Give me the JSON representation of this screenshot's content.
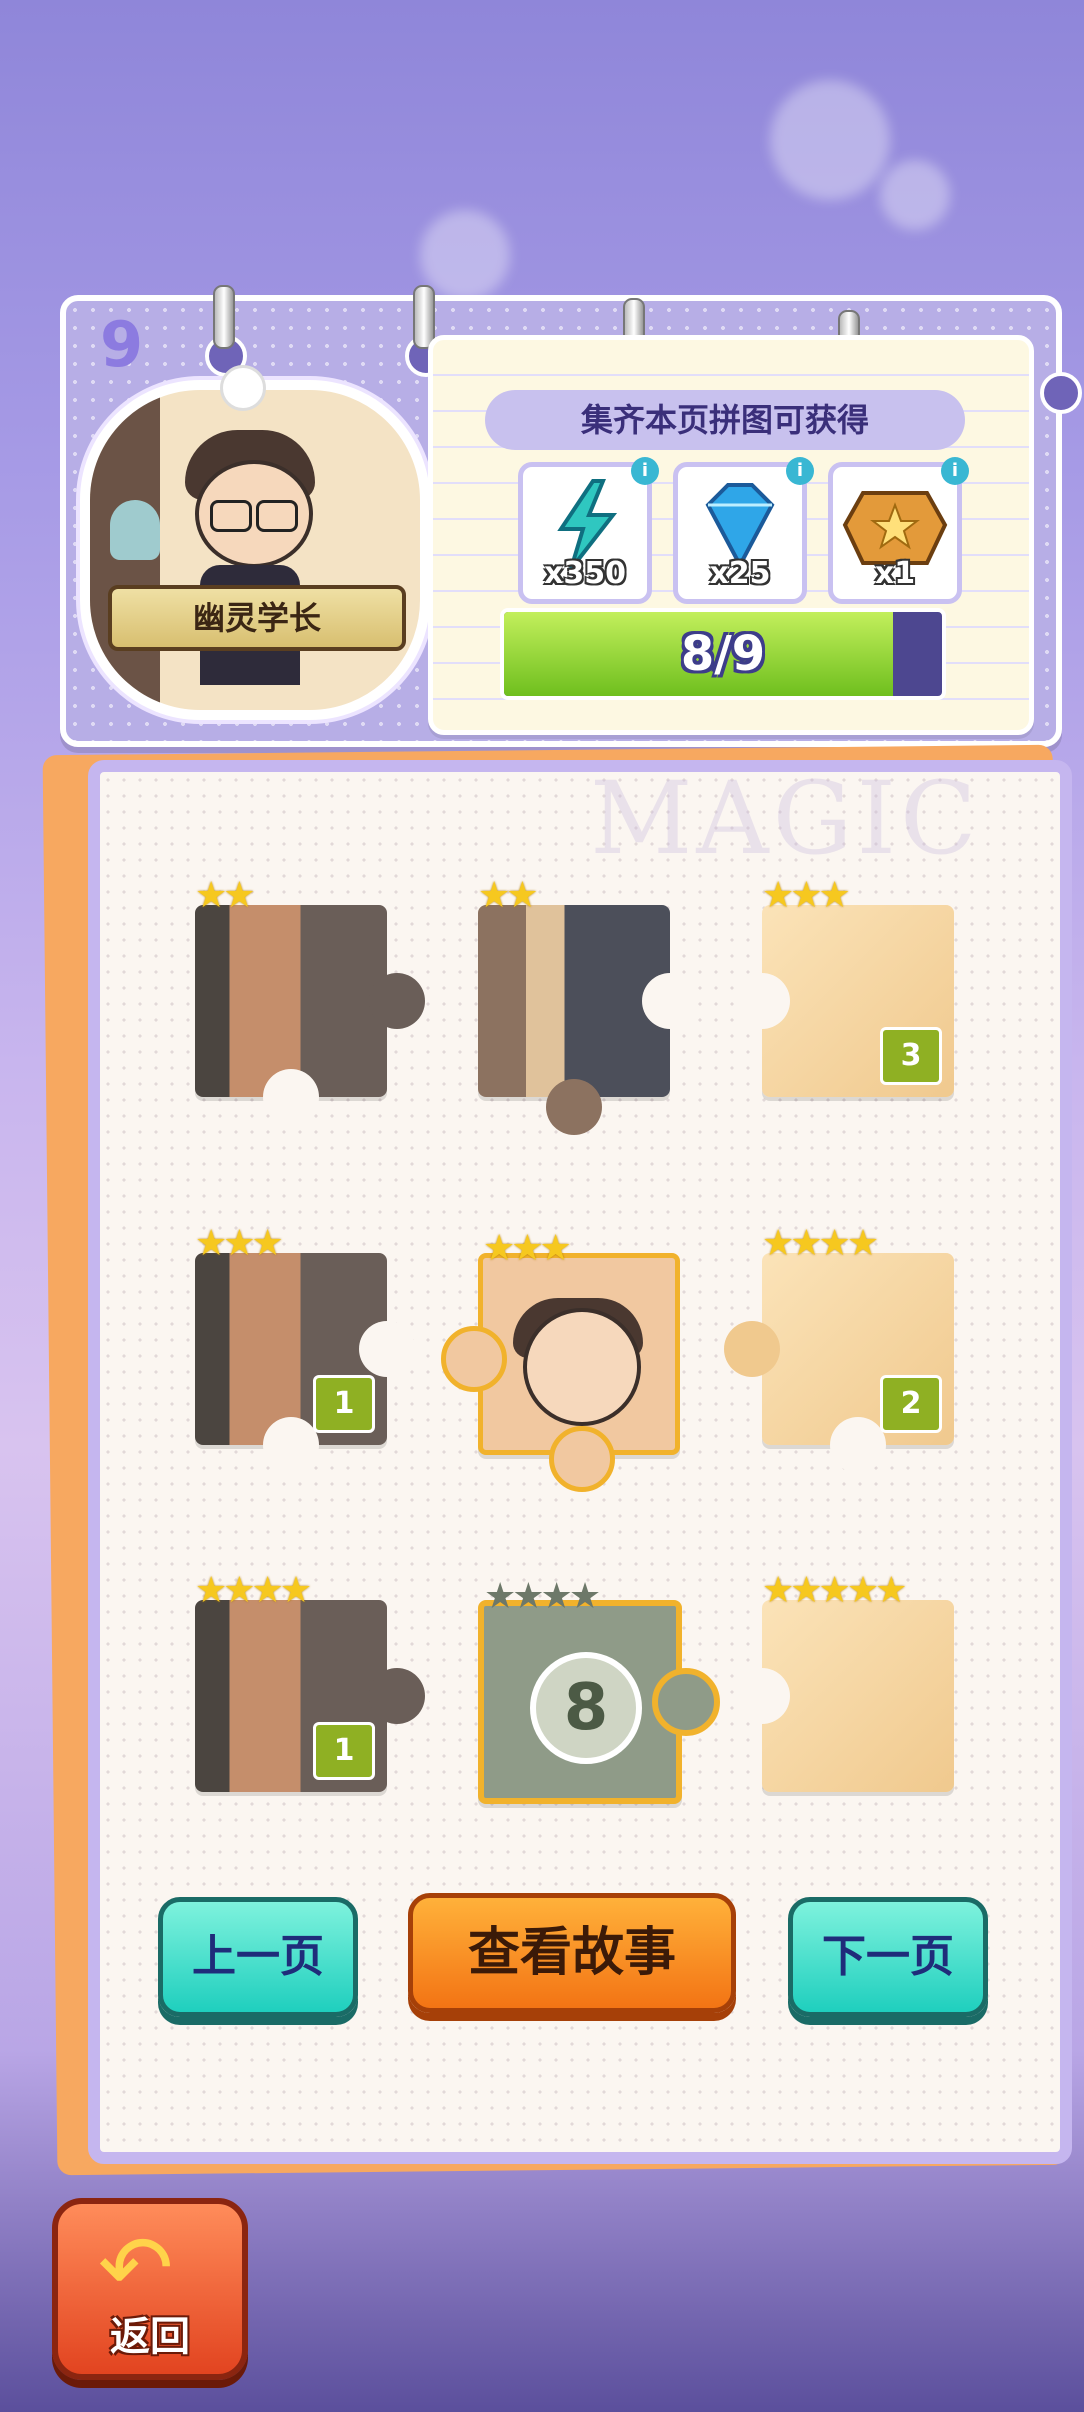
{
  "page_number": "9",
  "character": {
    "name": "幽灵学长"
  },
  "rewards": {
    "title": "集齐本页拼图可获得",
    "items": [
      {
        "icon": "lightning-icon",
        "count": "x350",
        "color": "#2fc7c0"
      },
      {
        "icon": "diamond-icon",
        "count": "x25",
        "color": "#2fa6e8"
      },
      {
        "icon": "treasure-chest-icon",
        "count": "x1",
        "color": "#e39a3a"
      }
    ],
    "info_glyph": "i"
  },
  "progress": {
    "text": "8/9",
    "current": 8,
    "total": 9
  },
  "watermark": "MAGIC",
  "pieces": [
    {
      "stars": 2,
      "badge": ""
    },
    {
      "stars": 2,
      "badge": ""
    },
    {
      "stars": 3,
      "badge": "3"
    },
    {
      "stars": 3,
      "badge": "1"
    },
    {
      "stars": 3,
      "badge": ""
    },
    {
      "stars": 4,
      "badge": "2"
    },
    {
      "stars": 4,
      "badge": "1"
    },
    {
      "stars": 4,
      "badge": "",
      "locked_number": "8"
    },
    {
      "stars": 5,
      "badge": ""
    }
  ],
  "buttons": {
    "prev": "上一页",
    "story": "查看故事",
    "next": "下一页",
    "back": "返回"
  }
}
